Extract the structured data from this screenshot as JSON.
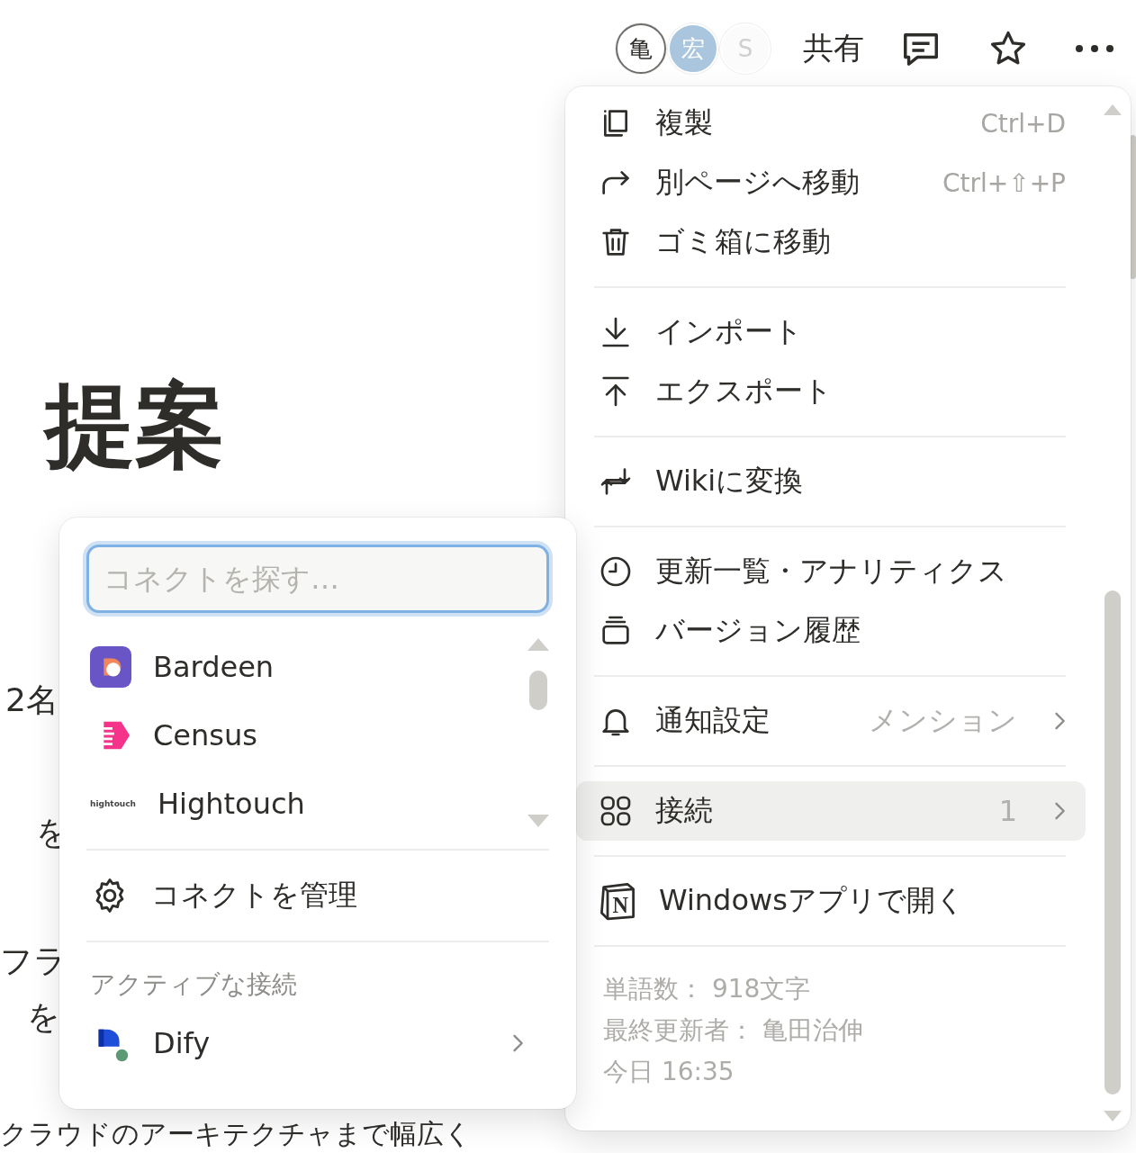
{
  "topbar": {
    "avatars": [
      {
        "initial": "亀",
        "color": "#ffffff"
      },
      {
        "initial": "宏",
        "color": "#a9c6de"
      },
      {
        "initial": "S",
        "color": "#fbfbfb"
      }
    ],
    "share": "共有"
  },
  "page": {
    "title": "提案",
    "lines": [
      "2名",
      "を",
      "フラ",
      "を",
      "クラウドのアーキテクチャまで幅広く"
    ]
  },
  "page_menu": {
    "groups": [
      {
        "items": [
          {
            "label": "複製",
            "shortcut": "Ctrl+D",
            "selected": false,
            "has_submenu": false
          },
          {
            "label": "別ページへ移動",
            "shortcut": "Ctrl+⇧+P",
            "selected": false,
            "has_submenu": false
          },
          {
            "label": "ゴミ箱に移動",
            "selected": false,
            "has_submenu": false
          }
        ]
      },
      {
        "items": [
          {
            "label": "インポート",
            "selected": false,
            "has_submenu": false
          },
          {
            "label": "エクスポート",
            "selected": false,
            "has_submenu": false
          }
        ]
      },
      {
        "items": [
          {
            "label": "Wikiに変換",
            "selected": false,
            "has_submenu": false
          }
        ]
      },
      {
        "items": [
          {
            "label": "更新一覧・アナリティクス",
            "selected": false,
            "has_submenu": false
          },
          {
            "label": "バージョン履歴",
            "selected": false,
            "has_submenu": false
          }
        ]
      },
      {
        "items": [
          {
            "label": "通知設定",
            "value": "メンション",
            "selected": false,
            "has_submenu": true
          }
        ]
      },
      {
        "items": [
          {
            "label": "接続",
            "value": "1",
            "selected": true,
            "has_submenu": true
          }
        ]
      },
      {
        "items": [
          {
            "label": "Windowsアプリで開く",
            "logo_text": "N",
            "selected": false,
            "has_submenu": false
          }
        ]
      }
    ],
    "footer": [
      "単語数： 918文字",
      "最終更新者： 亀田治伸",
      "今日 16:35"
    ]
  },
  "connect_popup": {
    "search": {
      "placeholder": "コネクトを探す…"
    },
    "apps": [
      {
        "name": "Bardeen"
      },
      {
        "name": "Census"
      },
      {
        "name": "Hightouch",
        "logo_text": "hightouch"
      }
    ],
    "manage": "コネクトを管理",
    "active_header": "アクティブな接続",
    "active": [
      {
        "name": "Dify",
        "has_submenu": true
      }
    ]
  }
}
